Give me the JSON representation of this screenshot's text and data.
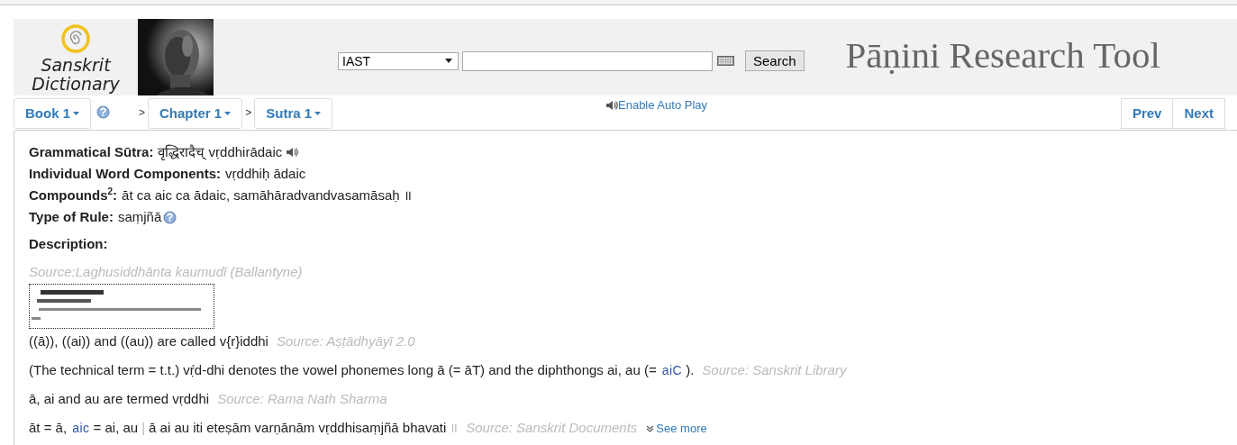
{
  "header": {
    "logo": {
      "line1": "Sanskrit",
      "line2": "Dictionary"
    },
    "script_select": {
      "value": "IAST"
    },
    "search_button": "Search",
    "title": "Pāṇini Research Tool"
  },
  "nav": {
    "book": "Book 1",
    "chapter": "Chapter 1",
    "sutra": "Sutra 1",
    "separators": [
      ">",
      ">"
    ],
    "auto_play": "Enable Auto Play",
    "prev": "Prev",
    "next": "Next"
  },
  "fields": [
    {
      "label": "Grammatical Sūtra:",
      "value": "वृद्धिरादैच् vṛddhirādaic",
      "kind": "audio"
    },
    {
      "label": "Individual Word Components:",
      "value": "vṛddhiḥ ādaic",
      "kind": "plain"
    },
    {
      "label": "Compounds$^{2}$:",
      "value": "āt ca aic ca ādaic, samāhāradvandvasamāsaḥ ॥",
      "kind": "plain"
    },
    {
      "label": "Type of Rule:",
      "value": "saṃjñā",
      "kind": "help"
    }
  ],
  "description": {
    "heading": "Description:",
    "entries": [
      {
        "source": "Source:Laghusiddhānta kaumudī (Ballantyne)"
      },
      {
        "kind": "text",
        "parts": [
          {
            "kind": "plain",
            "text": "((ā)), ((ai)) and ((au)) are called v{r}iddhi"
          }
        ],
        "source": "Source: Aṣṭādhyāyī 2.0"
      },
      {
        "kind": "text",
        "parts": [
          {
            "kind": "plain",
            "text": "(The technical term = t.t.) vṛ́d-dhi denotes the vowel phonemes long ā (= āT) and the diphthongs ai, au (="
          },
          {
            "kind": "term",
            "text": "aiC"
          },
          {
            "kind": "plain",
            "text": ")."
          }
        ],
        "source": "Source: Sanskrit Library"
      },
      {
        "kind": "text",
        "parts": [
          {
            "kind": "plain",
            "text": "ā, ai and au are termed vṛddhi"
          }
        ],
        "source": "Source: Rama Nath Sharma"
      },
      {
        "kind": "text",
        "parts": [
          {
            "kind": "plain",
            "text": "āt = ā,"
          },
          {
            "kind": "term",
            "text": "aic"
          },
          {
            "kind": "plain",
            "text": "= ai, au"
          },
          {
            "kind": "mark",
            "text": "|"
          },
          {
            "kind": "plain",
            "text": "ā ai au iti eteṣām varṇānām vṛddhisaṃjñā bhavati"
          },
          {
            "kind": "mark",
            "text": "॥"
          }
        ],
        "source": "Source: Sanskrit Documents",
        "more": "See more"
      }
    ]
  }
}
